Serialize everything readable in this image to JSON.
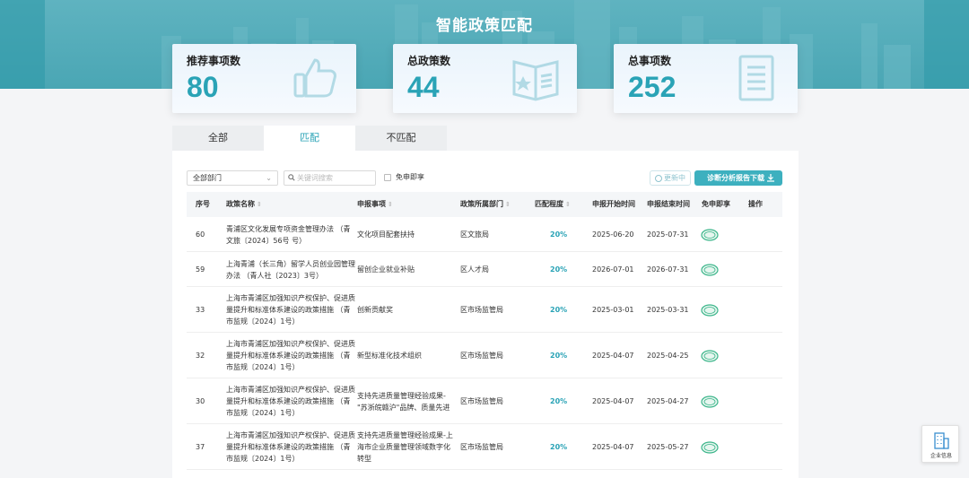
{
  "header": {
    "title": "智能政策匹配"
  },
  "stats": [
    {
      "label": "推荐事项数",
      "value": "80",
      "icon": "thumbs-up-icon"
    },
    {
      "label": "总政策数",
      "value": "44",
      "icon": "policy-book-icon"
    },
    {
      "label": "总事项数",
      "value": "252",
      "icon": "document-list-icon"
    }
  ],
  "tabs": [
    {
      "label": "全部",
      "active": false
    },
    {
      "label": "匹配",
      "active": true
    },
    {
      "label": "不匹配",
      "active": false
    }
  ],
  "filters": {
    "department": "全部部门",
    "search_placeholder": "关键词搜索",
    "exempt_label": "免申即享",
    "refresh_label": "更新中",
    "download_label": "诊断分析报告下载"
  },
  "table": {
    "columns": [
      "序号",
      "政策名称",
      "申报事项",
      "政策所属部门",
      "匹配程度",
      "申报开始时间",
      "申报结束时间",
      "免申即享",
      "操作"
    ],
    "rows": [
      {
        "id": "60",
        "policy": [
          "青浦区文化发展专项资金管理办法 （青",
          "文旅〔2024〕56号 号）"
        ],
        "item": [
          "文化项目配套扶持"
        ],
        "dept": "区文旅局",
        "match": "20%",
        "start": "2025-06-20",
        "end": "2025-07-31"
      },
      {
        "id": "59",
        "policy": [
          "上海青浦（长三角）留学人员创业园管理",
          "办法 （青人社〔2023〕3号）"
        ],
        "item": [
          "留创企业就业补贴"
        ],
        "dept": "区人才局",
        "match": "20%",
        "start": "2026-07-01",
        "end": "2026-07-31"
      },
      {
        "id": "33",
        "policy": [
          "上海市青浦区加强知识产权保护、促进质",
          "量提升和标准体系建设的政策措施 （青",
          "市监规〔2024〕1号）"
        ],
        "item": [
          "创新贡献奖"
        ],
        "dept": "区市场监管局",
        "match": "20%",
        "start": "2025-03-01",
        "end": "2025-03-31"
      },
      {
        "id": "32",
        "policy": [
          "上海市青浦区加强知识产权保护、促进质",
          "量提升和标准体系建设的政策措施 （青",
          "市监规〔2024〕1号）"
        ],
        "item": [
          "新型标准化技术组织"
        ],
        "dept": "区市场监管局",
        "match": "20%",
        "start": "2025-04-07",
        "end": "2025-04-25"
      },
      {
        "id": "30",
        "policy": [
          "上海市青浦区加强知识产权保护、促进质",
          "量提升和标准体系建设的政策措施 （青",
          "市监规〔2024〕1号）"
        ],
        "item": [
          "支持先进质量管理经验成果-",
          "\"苏浙皖赣沪\"品牌、质量先进"
        ],
        "dept": "区市场监管局",
        "match": "20%",
        "start": "2025-04-07",
        "end": "2025-04-27"
      },
      {
        "id": "37",
        "policy": [
          "上海市青浦区加强知识产权保护、促进质",
          "量提升和标准体系建设的政策措施 （青",
          "市监规〔2024〕1号）"
        ],
        "item": [
          "支持先进质量管理经验成果-上",
          "海市企业质量管理领域数字化",
          "转型"
        ],
        "dept": "区市场监管局",
        "match": "20%",
        "start": "2025-04-07",
        "end": "2025-05-27"
      }
    ]
  },
  "float_button": {
    "label": "企业信息"
  },
  "colors": {
    "accent": "#2aa3b6",
    "banner": "#4aa6b4",
    "button": "#3db0bf",
    "stamp": "#3bb58a"
  }
}
